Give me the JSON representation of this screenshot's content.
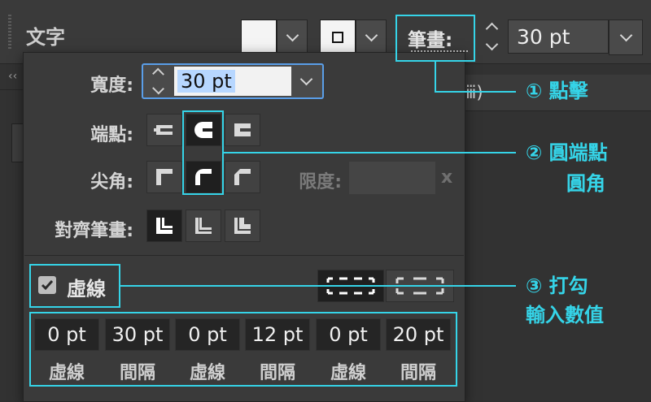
{
  "toolbar": {
    "title": "文字",
    "stroke_label": "筆畫:",
    "stroke_value": "30 pt"
  },
  "background": {
    "collapse": "‹‹",
    "tab_fragment": "ⅲ)"
  },
  "popup": {
    "weight_label": "寬度:",
    "weight_value": "30 pt",
    "cap_label": "端點:",
    "corner_label": "尖角:",
    "limit_label": "限度:",
    "limit_unit": "x",
    "align_label": "對齊筆畫:",
    "dashed_label": "虛線",
    "dashed_checked": true,
    "dash_values": [
      "0 pt",
      "30 pt",
      "0 pt",
      "12 pt",
      "0 pt",
      "20 pt"
    ],
    "dash_labels": [
      "虛線",
      "間隔",
      "虛線",
      "間隔",
      "虛線",
      "間隔"
    ]
  },
  "annotations": {
    "a1": "① 點擊",
    "a2_line1": "② 圓端點",
    "a2_line2": "圓角",
    "a3_line1": "③ 打勾",
    "a3_line2": "輸入數值"
  },
  "colors": {
    "annotation": "#35d4e8",
    "selection": "#b7d7ff"
  }
}
